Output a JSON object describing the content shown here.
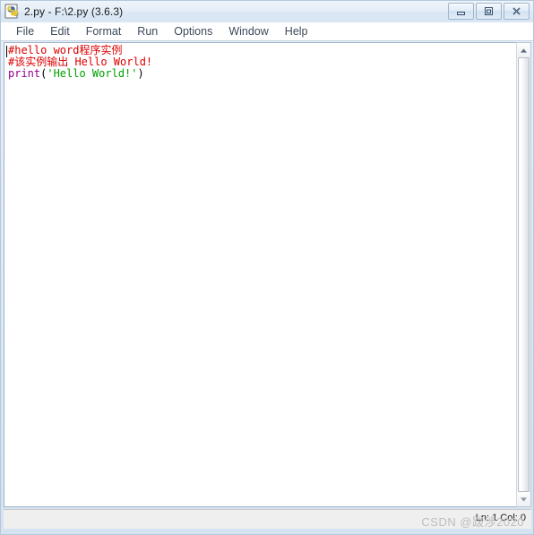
{
  "window": {
    "title": "2.py - F:\\2.py (3.6.3)",
    "icon": "python-idle-icon",
    "controls": {
      "minimize_label": "Minimize",
      "maximize_label": "Maximize",
      "close_label": "Close"
    }
  },
  "menubar": {
    "items": [
      {
        "label": "File"
      },
      {
        "label": "Edit"
      },
      {
        "label": "Format"
      },
      {
        "label": "Run"
      },
      {
        "label": "Options"
      },
      {
        "label": "Window"
      },
      {
        "label": "Help"
      }
    ]
  },
  "editor": {
    "lines": [
      {
        "tokens": [
          {
            "text": "#hello word程序实例",
            "type": "comment"
          }
        ]
      },
      {
        "tokens": [
          {
            "text": "#该实例输出 Hello World!",
            "type": "comment"
          }
        ]
      },
      {
        "tokens": [
          {
            "text": "print",
            "type": "builtin"
          },
          {
            "text": "(",
            "type": "plain"
          },
          {
            "text": "'Hello World!'",
            "type": "string"
          },
          {
            "text": ")",
            "type": "plain"
          }
        ]
      }
    ],
    "plain_text": "#hello word程序实例\n#该实例输出 Hello World!\nprint('Hello World!')",
    "colors": {
      "comment": "#dd0000",
      "builtin": "#900090",
      "string": "#00a000",
      "plain": "#000000",
      "background": "#ffffff"
    }
  },
  "scrollbar": {
    "up_arrow": "scroll-up-icon",
    "down_arrow": "scroll-down-icon"
  },
  "statusbar": {
    "position": "Ln: 1 Col: 0",
    "watermark": "CSDN @跋涉2020"
  }
}
